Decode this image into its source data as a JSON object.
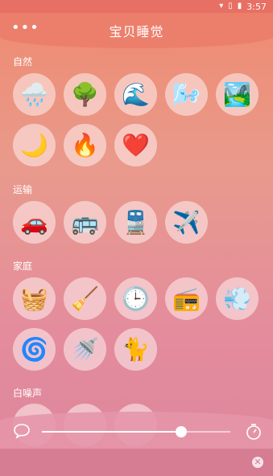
{
  "status_bar": {
    "time": "3:57"
  },
  "header": {
    "title": "宝贝睡觉",
    "menu_icon": "more-dots-icon"
  },
  "sections": [
    {
      "title": "自然",
      "items": [
        {
          "name": "rain",
          "icon": "🌧️"
        },
        {
          "name": "forest",
          "icon": "🌳"
        },
        {
          "name": "waves",
          "icon": "🌊"
        },
        {
          "name": "wind",
          "icon": "🌬️"
        },
        {
          "name": "river",
          "icon": "🏞️"
        },
        {
          "name": "night",
          "icon": "🌙"
        },
        {
          "name": "fire",
          "icon": "🔥"
        },
        {
          "name": "heartbeat",
          "icon": "❤️"
        }
      ]
    },
    {
      "title": "运输",
      "items": [
        {
          "name": "car",
          "icon": "🚗"
        },
        {
          "name": "bus",
          "icon": "🚌"
        },
        {
          "name": "train",
          "icon": "🚆"
        },
        {
          "name": "airplane",
          "icon": "✈️"
        }
      ]
    },
    {
      "title": "家庭",
      "items": [
        {
          "name": "washing-machine",
          "icon": "🧺"
        },
        {
          "name": "vacuum",
          "icon": "🧹"
        },
        {
          "name": "clock",
          "icon": "🕒"
        },
        {
          "name": "radio",
          "icon": "📻"
        },
        {
          "name": "hair-dryer",
          "icon": "💨"
        },
        {
          "name": "fan",
          "icon": "🌀"
        },
        {
          "name": "shower",
          "icon": "🚿"
        },
        {
          "name": "cat",
          "icon": "🐈"
        }
      ]
    },
    {
      "title": "白噪声",
      "items": []
    }
  ],
  "player": {
    "volume": 0.74
  }
}
